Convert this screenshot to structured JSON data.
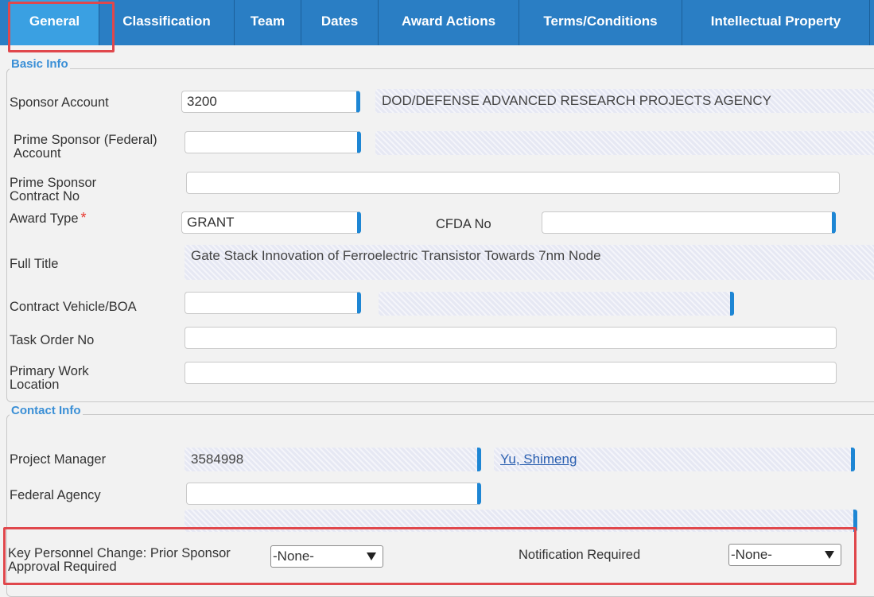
{
  "tabs": [
    {
      "label": "General",
      "active": true
    },
    {
      "label": "Classification"
    },
    {
      "label": "Team"
    },
    {
      "label": "Dates"
    },
    {
      "label": "Award Actions"
    },
    {
      "label": "Terms/Conditions"
    },
    {
      "label": "Intellectual Property"
    }
  ],
  "basic_info": {
    "legend": "Basic Info",
    "sponsor_account": {
      "label": "Sponsor Account",
      "value": "3200",
      "name": "DOD/DEFENSE ADVANCED RESEARCH PROJECTS AGENCY"
    },
    "prime_sponsor_account": {
      "label": "Prime Sponsor (Federal) Account",
      "value": "",
      "name": ""
    },
    "prime_sponsor_contract": {
      "label": "Prime Sponsor Contract No",
      "value": ""
    },
    "award_type": {
      "label": "Award Type",
      "required_mark": "*",
      "value": "GRANT"
    },
    "cfda_no": {
      "label": "CFDA No",
      "value": ""
    },
    "full_title": {
      "label": "Full Title",
      "value": "Gate Stack Innovation of Ferroelectric Transistor Towards 7nm Node"
    },
    "contract_vehicle": {
      "label": "Contract Vehicle/BOA",
      "value": "",
      "name": ""
    },
    "task_order": {
      "label": "Task Order No",
      "value": ""
    },
    "primary_work_location": {
      "label": "Primary Work Location",
      "value": ""
    }
  },
  "contact_info": {
    "legend": "Contact Info",
    "project_manager": {
      "label": "Project Manager",
      "id": "3584998",
      "name": "Yu, Shimeng"
    },
    "federal_agency": {
      "label": "Federal Agency",
      "value": "",
      "name": ""
    }
  },
  "key_personnel": {
    "label": "Key Personnel Change: Prior Sponsor Approval Required",
    "value": "-None-",
    "notification_label": "Notification Required",
    "notification_value": "-None-"
  },
  "colors": {
    "tab_bar": "#2a7ec4",
    "tab_active": "#3aa0e2",
    "highlight": "#e0474c",
    "legend": "#3a8fd6",
    "lookup_accent": "#1e86d4"
  }
}
